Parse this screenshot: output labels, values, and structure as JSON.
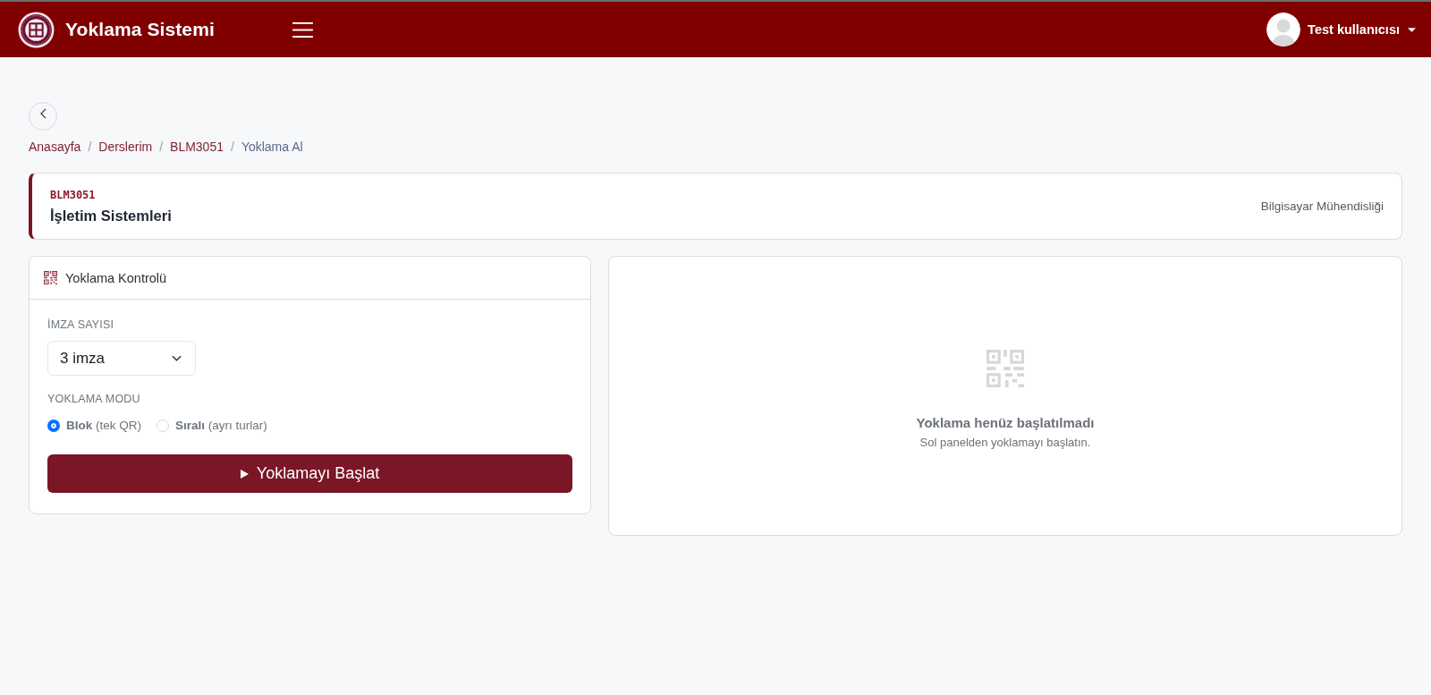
{
  "header": {
    "title": "Yoklama Sistemi",
    "user": {
      "name": "Test kullanıcısı"
    }
  },
  "breadcrumb": [
    {
      "label": "Anasayfa",
      "current": false
    },
    {
      "separator": "/",
      "label": "Derslerim",
      "current": false
    },
    {
      "separator": "/",
      "label": "BLM3051",
      "current": false
    },
    {
      "separator": "/",
      "label": "Yoklama Al",
      "current": true
    }
  ],
  "course": {
    "code": "BLM3051",
    "name": "İşletim Sistemleri",
    "department": "Bilgisayar Mühendisliği"
  },
  "control_panel": {
    "title": "Yoklama Kontrolü",
    "signature_count": {
      "label": "İMZA SAYISI",
      "value": "3 imza"
    },
    "mode": {
      "label": "YOKLAMA MODU",
      "options": [
        {
          "label": "**Blok** (tek QR)",
          "selected": true
        },
        {
          "label": "**Sıralı** (ayrı turlar)",
          "selected": false
        }
      ]
    },
    "start_button": {
      "label": "Yoklamayı Başlat"
    }
  },
  "status_panel": {
    "title": "Yoklama henüz başlatılmadı",
    "message": "Sol panelden yoklamayı başlatın."
  }
}
